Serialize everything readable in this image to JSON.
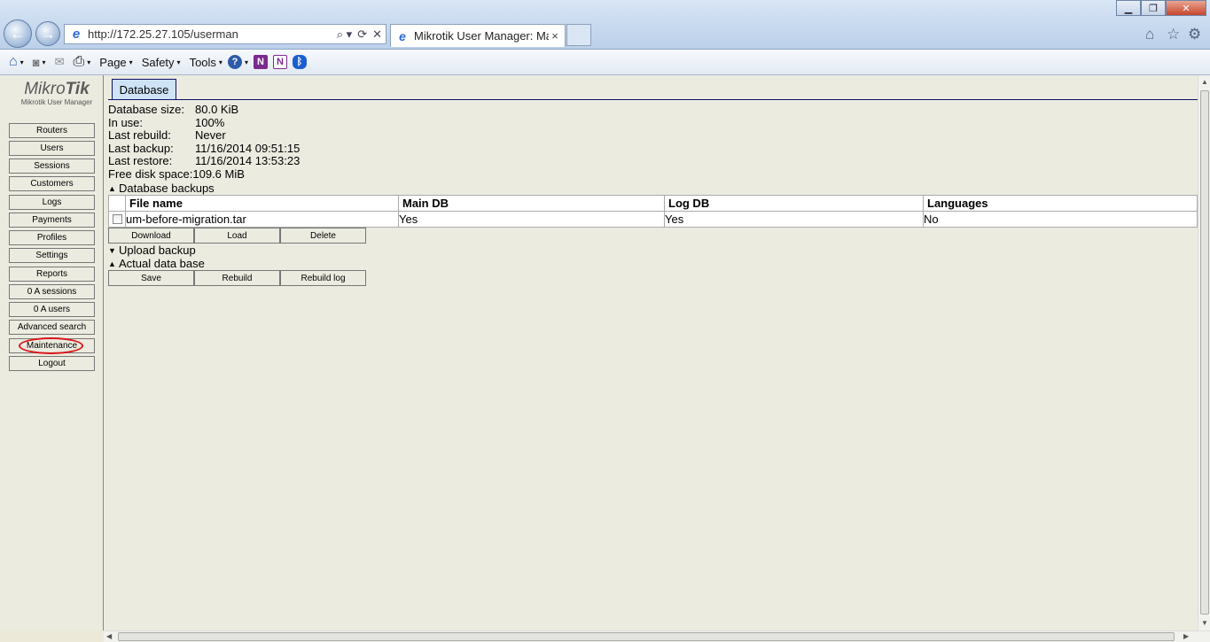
{
  "browser": {
    "url": "http://172.25.27.105/userman",
    "tab_title": "Mikrotik User Manager: Mai...",
    "tab_close": "×",
    "back": "←",
    "forward": "→",
    "search_glyph": "⌕ ▾",
    "refresh_glyph": "⟳",
    "stop_glyph": "✕",
    "minimize": "▁",
    "maximize": "❐",
    "close": "✕",
    "home_glyph": "⌂",
    "favorites_glyph": "☆",
    "settings_glyph": "⚙"
  },
  "commandbar": {
    "page": "Page",
    "safety": "Safety",
    "tools": "Tools",
    "help": "?",
    "onenote1": "N",
    "onenote2": "N",
    "bluetooth": "ᛒ",
    "home": "⌂",
    "feeds": "◙",
    "mail": "✉",
    "print": "⎙",
    "caret": "▾"
  },
  "logo": {
    "main_light": "Mikro",
    "main_bold": "Tik",
    "sub": "Mikrotik User Manager"
  },
  "sidebar": {
    "items": [
      "Routers",
      "Users",
      "Sessions",
      "Customers",
      "Logs",
      "Payments",
      "Profiles",
      "Settings",
      "Reports",
      "0 A sessions",
      "0 A users",
      "Advanced search",
      "Maintenance",
      "Logout"
    ]
  },
  "main": {
    "tab": "Database",
    "info": [
      {
        "label": "Database size:",
        "value": "80.0 KiB"
      },
      {
        "label": "In use:",
        "value": "100%"
      },
      {
        "label": "Last rebuild:",
        "value": "Never"
      },
      {
        "label": "Last backup:",
        "value": "11/16/2014 09:51:15"
      },
      {
        "label": "Last restore:",
        "value": "11/16/2014 13:53:23"
      },
      {
        "label": "Free disk space:",
        "value": "109.6 MiB"
      }
    ],
    "backups_section": "Database backups",
    "backups_table": {
      "headers": [
        "File name",
        "Main DB",
        "Log DB",
        "Languages"
      ],
      "rows": [
        [
          "um-before-migration.tar",
          "Yes",
          "Yes",
          "No"
        ]
      ]
    },
    "backup_buttons": [
      "Download",
      "Load",
      "Delete"
    ],
    "upload_section": "Upload backup",
    "actual_section": "Actual data base",
    "db_buttons": [
      "Save",
      "Rebuild",
      "Rebuild log"
    ],
    "tri_up": "▲",
    "tri_down": "▼"
  }
}
